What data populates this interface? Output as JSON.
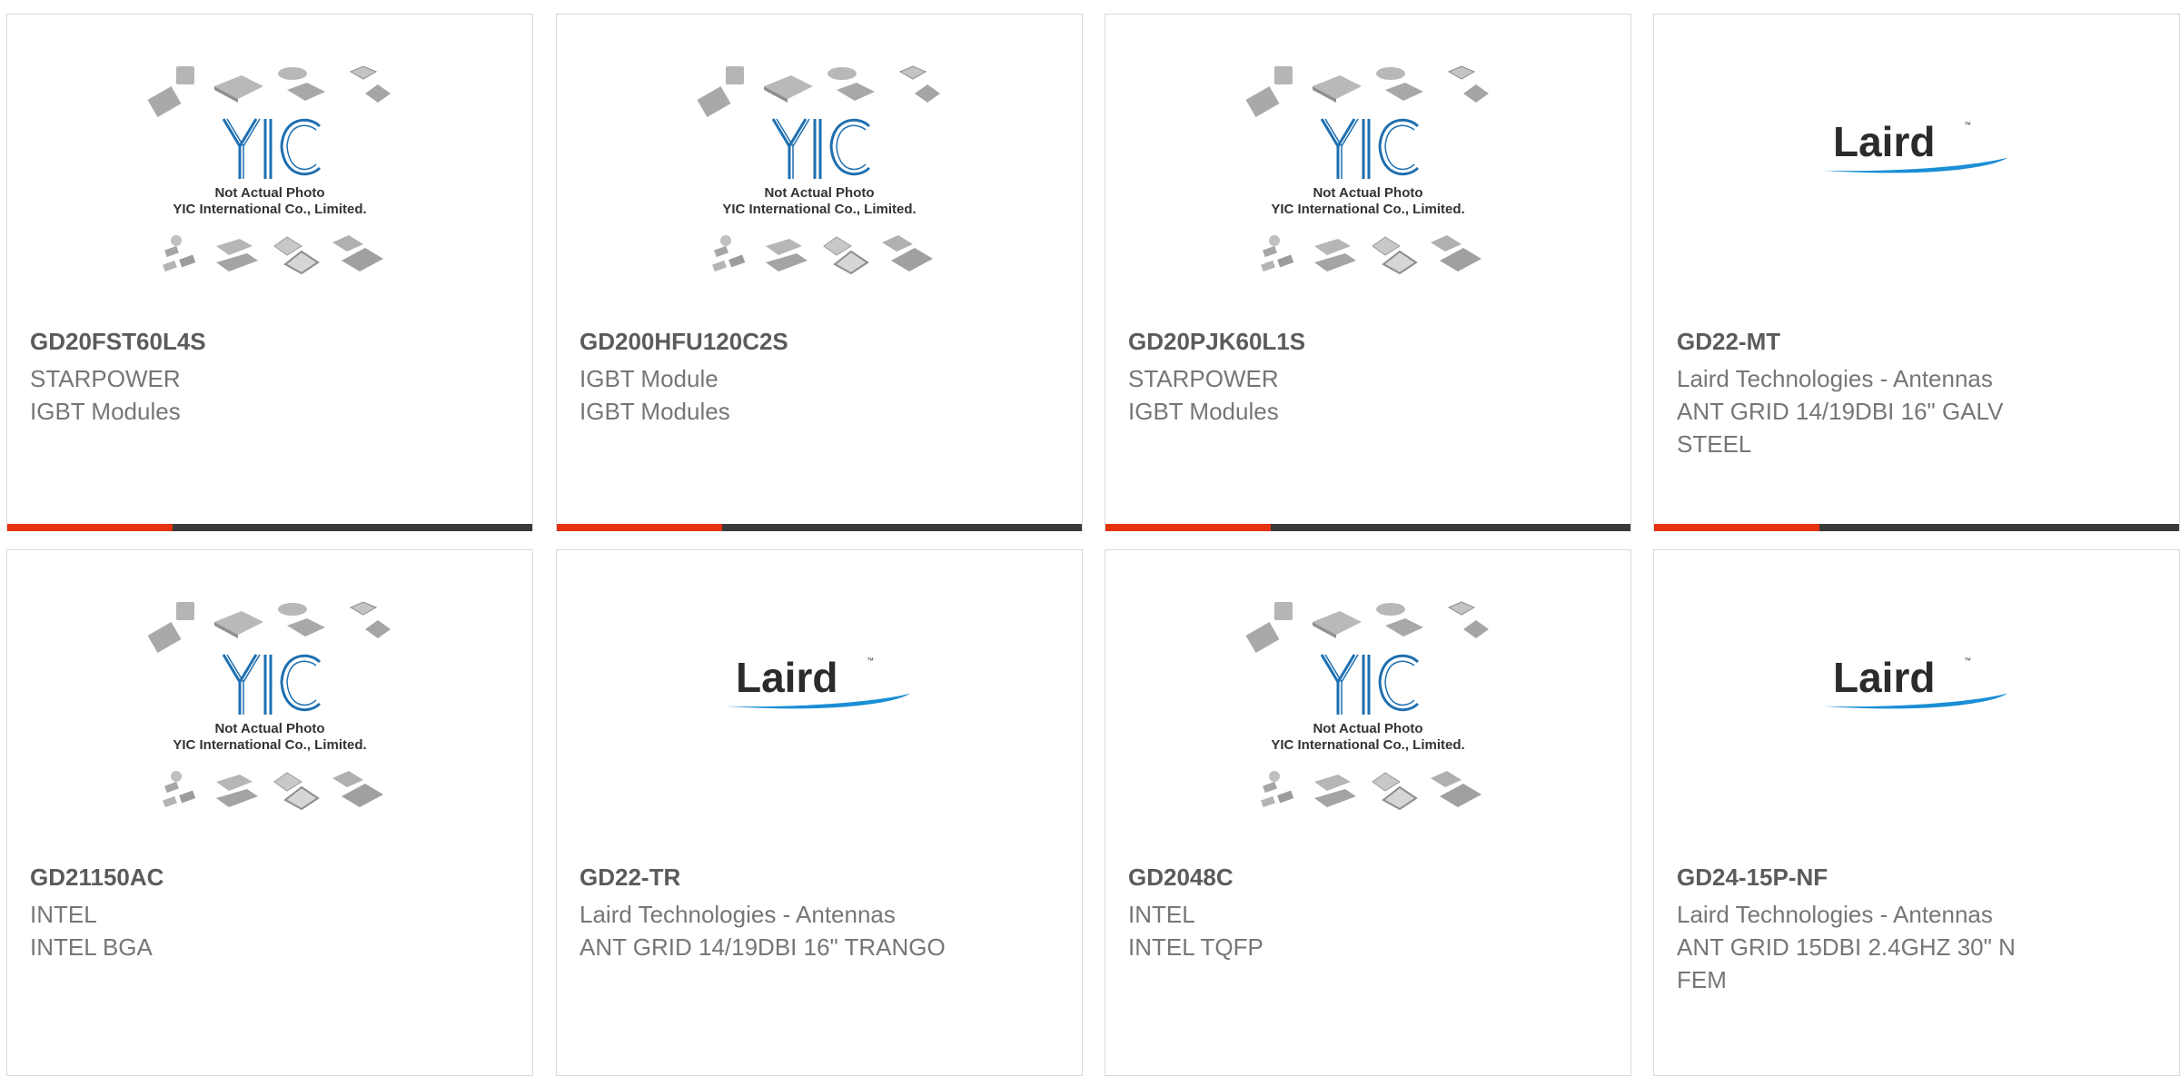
{
  "placeholder_photo": {
    "caption_line1": "Not Actual Photo",
    "caption_line2": "YIC International Co., Limited.",
    "logo_text": "YIC"
  },
  "laird_logo_text": "Laird",
  "colors": {
    "accent": "#e5330f",
    "bar": "#3b3b3b",
    "yic_blue": "#1e6fb0",
    "laird_blue": "#1a8ed6"
  },
  "products": [
    {
      "part": "GD20FST60L4S",
      "brand": "STARPOWER",
      "desc": "IGBT Modules",
      "image": "yic"
    },
    {
      "part": "GD200HFU120C2S",
      "brand": "IGBT Module",
      "desc": "IGBT Modules",
      "image": "yic"
    },
    {
      "part": "GD20PJK60L1S",
      "brand": "STARPOWER",
      "desc": "IGBT Modules",
      "image": "yic"
    },
    {
      "part": "GD22-MT",
      "brand": "Laird Technologies - Antennas",
      "desc": "ANT GRID 14/19DBI 16\" GALV STEEL",
      "image": "laird"
    },
    {
      "part": "GD21150AC",
      "brand": "INTEL",
      "desc": "INTEL BGA",
      "image": "yic"
    },
    {
      "part": "GD22-TR",
      "brand": "Laird Technologies - Antennas",
      "desc": "ANT GRID 14/19DBI 16\" TRANGO",
      "image": "laird"
    },
    {
      "part": "GD2048C",
      "brand": "INTEL",
      "desc": "INTEL TQFP",
      "image": "yic"
    },
    {
      "part": "GD24-15P-NF",
      "brand": "Laird Technologies - Antennas",
      "desc": "ANT GRID 15DBI 2.4GHZ 30\" N FEM",
      "image": "laird"
    }
  ]
}
